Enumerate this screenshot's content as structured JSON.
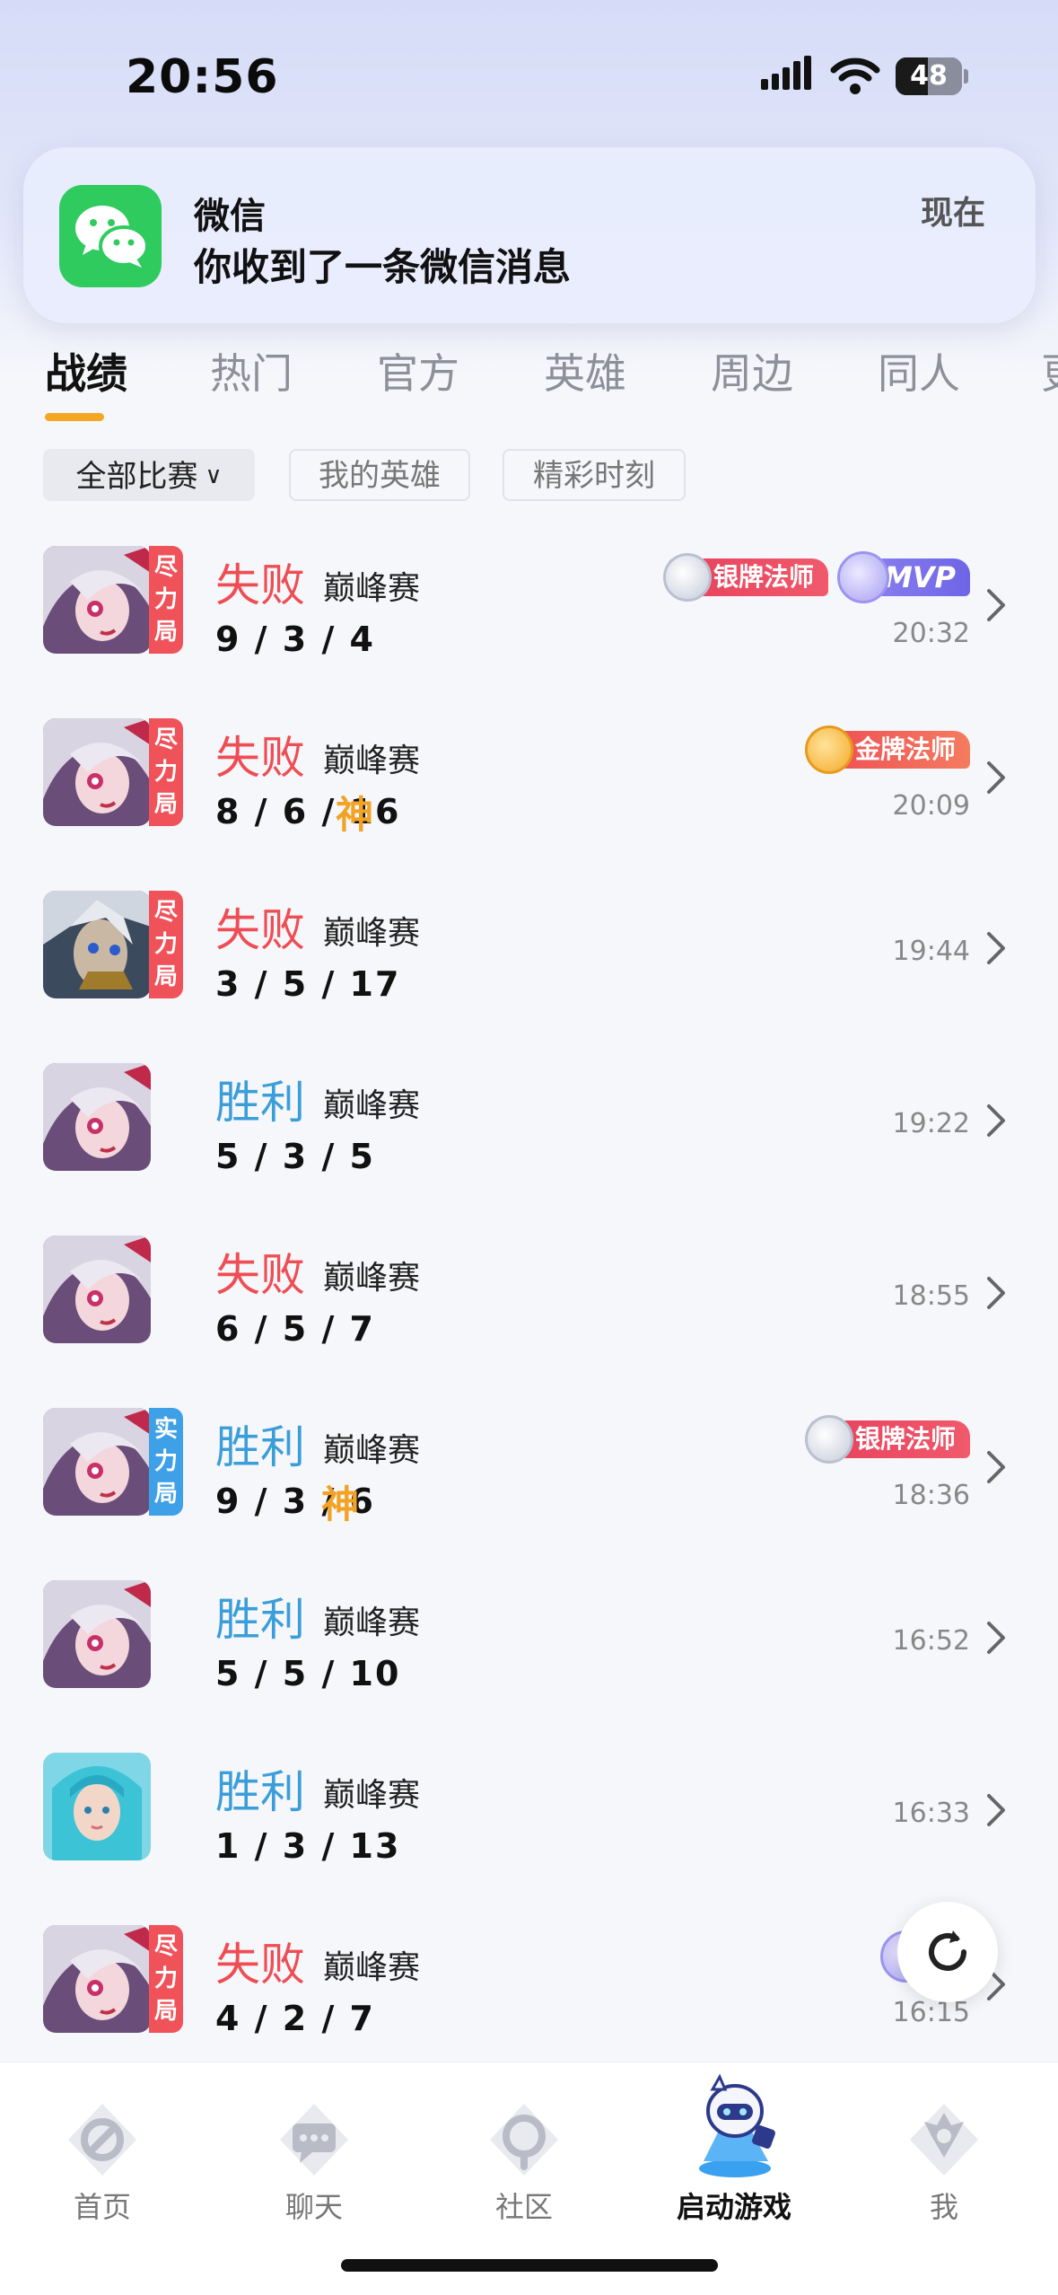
{
  "status_bar": {
    "time": "20:56",
    "battery": "48",
    "battery_level": 0.48
  },
  "notification": {
    "app": "微信",
    "message": "你收到了一条微信消息",
    "time": "现在",
    "icon": "wechat-icon",
    "icon_color": "#2fcb5e"
  },
  "tabs": [
    {
      "label": "战绩",
      "active": true
    },
    {
      "label": "热门"
    },
    {
      "label": "官方"
    },
    {
      "label": "英雄"
    },
    {
      "label": "周边"
    },
    {
      "label": "同人"
    },
    {
      "label": "更"
    }
  ],
  "filters": [
    {
      "label": "全部比赛",
      "active": true
    },
    {
      "label": "我的英雄"
    },
    {
      "label": "精彩时刻"
    }
  ],
  "matches": [
    {
      "result": "失败",
      "outcome": "lose",
      "mode": "巅峰赛",
      "kda": "9 / 3 / 4",
      "time": "20:32",
      "tag": [
        "尽",
        "力",
        "局"
      ],
      "tag_color": "red",
      "badge": "银牌法师",
      "badge_type": "silver",
      "mvp": "MVP"
    },
    {
      "result": "失败",
      "outcome": "lose",
      "mode": "巅峰赛",
      "kda": "8 / 6 / 16",
      "god": "神",
      "time": "20:09",
      "tag": [
        "尽",
        "力",
        "局"
      ],
      "tag_color": "red",
      "badge": "金牌法师",
      "badge_type": "gold"
    },
    {
      "result": "失败",
      "outcome": "lose",
      "mode": "巅峰赛",
      "kda": "3 / 5 / 17",
      "time": "19:44",
      "tag": [
        "尽",
        "力",
        "局"
      ],
      "tag_color": "red",
      "avatar": "male-warrior"
    },
    {
      "result": "胜利",
      "outcome": "win",
      "mode": "巅峰赛",
      "kda": "5 / 3 / 5",
      "time": "19:22"
    },
    {
      "result": "失败",
      "outcome": "lose",
      "mode": "巅峰赛",
      "kda": "6 / 5 / 7",
      "time": "18:55"
    },
    {
      "result": "胜利",
      "outcome": "win",
      "mode": "巅峰赛",
      "kda": "9 / 3 / 6",
      "god": "神",
      "time": "18:36",
      "tag": [
        "实",
        "力",
        "局"
      ],
      "tag_color": "blue",
      "badge": "银牌法师",
      "badge_type": "silver"
    },
    {
      "result": "胜利",
      "outcome": "win",
      "mode": "巅峰赛",
      "kda": "5 / 5 / 10",
      "time": "16:52"
    },
    {
      "result": "胜利",
      "outcome": "win",
      "mode": "巅峰赛",
      "kda": "1 / 3 / 13",
      "time": "16:33",
      "avatar": "teal-hair"
    },
    {
      "result": "失败",
      "outcome": "lose",
      "mode": "巅峰赛",
      "kda": "4 / 2 / 7",
      "time": "16:15",
      "tag": [
        "尽",
        "力",
        "局"
      ],
      "tag_color": "red",
      "mvp_partial": true
    }
  ],
  "bottom_nav": [
    {
      "label": "首页",
      "icon": "home-icon"
    },
    {
      "label": "聊天",
      "icon": "chat-icon"
    },
    {
      "label": "社区",
      "icon": "community-icon"
    },
    {
      "label": "启动游戏",
      "icon": "launch-game-mascot-icon",
      "active": true
    },
    {
      "label": "我",
      "icon": "profile-icon"
    }
  ]
}
